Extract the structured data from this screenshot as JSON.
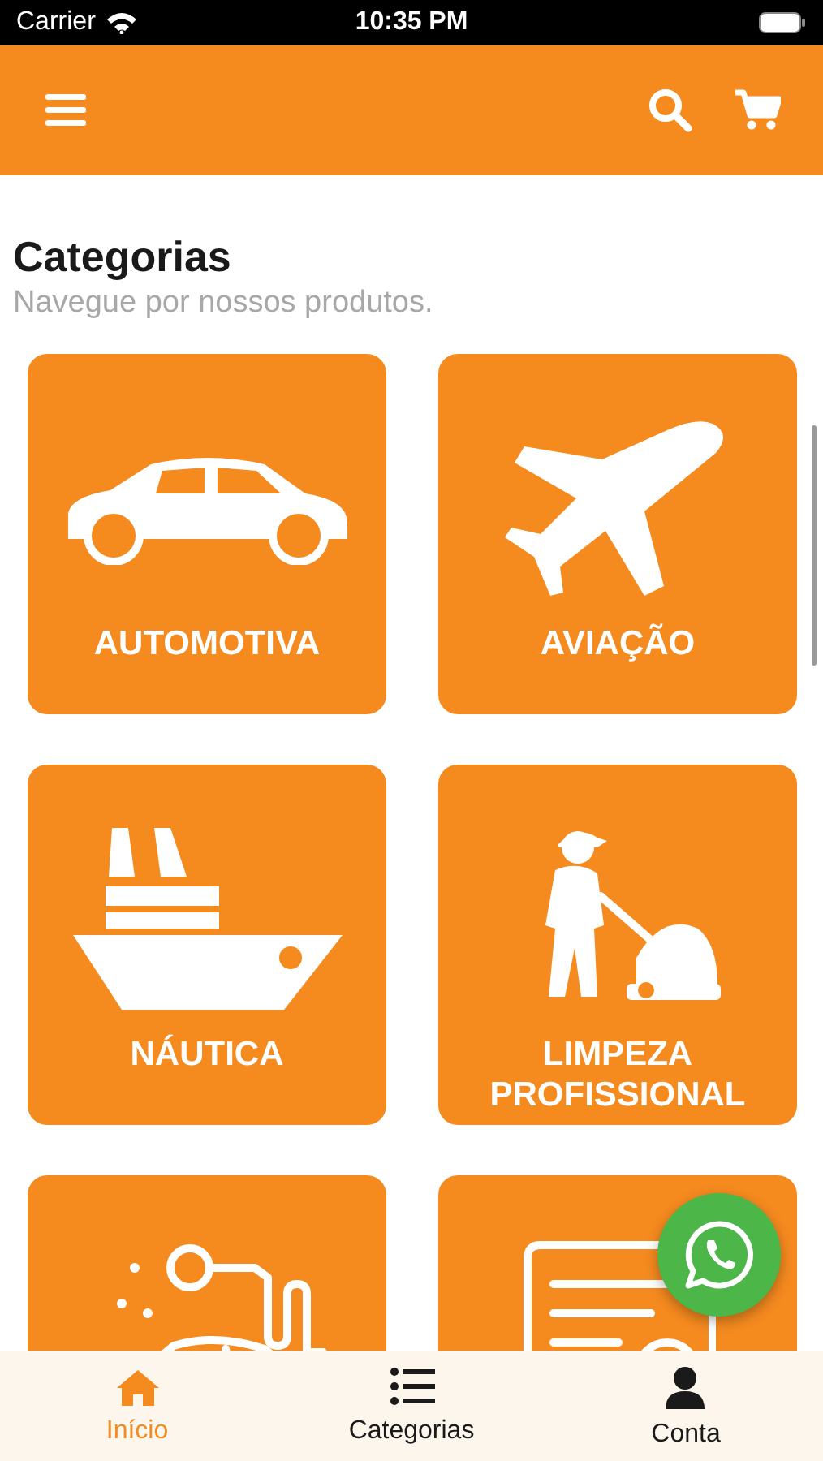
{
  "status_bar": {
    "carrier": "Carrier",
    "time": "10:35 PM"
  },
  "heading": {
    "title": "Categorias",
    "subtitle": "Navegue por nossos produtos."
  },
  "categories": [
    {
      "kind": "labeled",
      "label": "AUTOMOTIVA"
    },
    {
      "kind": "labeled",
      "label": "AVIAÇÃO"
    },
    {
      "kind": "labeled",
      "label": "NÁUTICA"
    },
    {
      "kind": "labeled",
      "label": "LIMPEZA PROFISSIONAL"
    },
    {
      "kind": "unlabeled"
    },
    {
      "kind": "unlabeled"
    }
  ],
  "bottom_nav": [
    {
      "label": "Início",
      "selected": true
    },
    {
      "label": "Categorias",
      "selected": false
    },
    {
      "label": "Conta",
      "selected": false
    }
  ]
}
